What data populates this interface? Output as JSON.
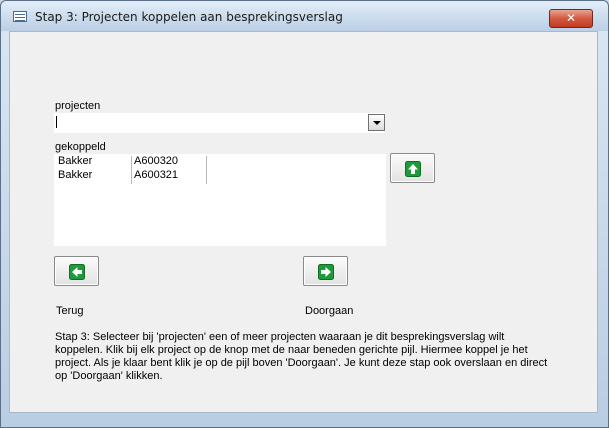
{
  "window": {
    "title": "Stap 3: Projecten koppelen aan besprekingsverslag",
    "close_label": "✕"
  },
  "form": {
    "projecten_label": "projecten",
    "projecten_value": "",
    "gekoppeld_label": "gekoppeld",
    "gekoppeld_rows": [
      {
        "name": "Bakker",
        "code": "A600320"
      },
      {
        "name": "Bakker",
        "code": "A600321"
      }
    ],
    "terug_label": "Terug",
    "doorgaan_label": "Doorgaan",
    "help_text": "Stap 3: Selecteer bij 'projecten' een of meer projecten waaraan je dit besprekingsverslag wilt koppelen. Klik bij elk project op de knop met de naar beneden gerichte pijl. Hiermee koppel je het project. Als je klaar bent klik je op de pijl boven 'Doorgaan'. Je kunt deze stap ook overslaan en direct op 'Doorgaan' klikken."
  },
  "colors": {
    "button_icon_green": "#1f9a3a",
    "close_red": "#c8462d"
  },
  "icons": {
    "up": "arrow-up-icon",
    "left": "arrow-left-icon",
    "right": "arrow-right-icon"
  }
}
